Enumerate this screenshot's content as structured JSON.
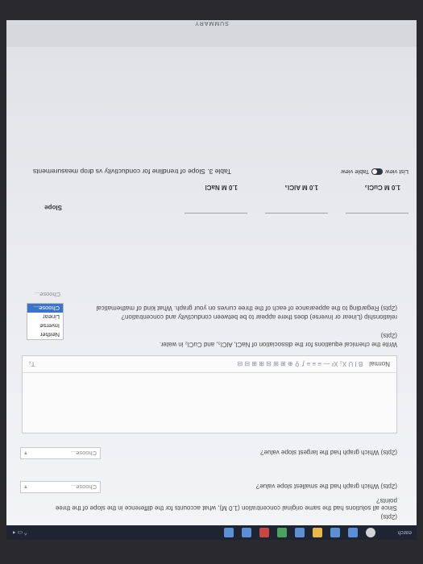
{
  "taskbar": {
    "search_label": "earch",
    "tray_text": "^ ▭ ◂"
  },
  "q_last": {
    "points": "(2pts)",
    "question": "Since all solutions had the same original concentration (1.0 M), what accounts for the difference in the slope of the three points?"
  },
  "q_smallest": {
    "question": "(2pts)  Which graph had the smallest slope value?",
    "select": "Choose..."
  },
  "q_largest": {
    "question": "(2pts)  Which graph had the largest slope value?",
    "select": "Choose..."
  },
  "editor": {
    "format": "Normal",
    "tools": "B  I  U     X₂  X²  —     ≡ ≡ ≡     ƒ   ⚲   ⊕   ⊞     ⊞ ⊟ ⊞  ⊞ ⊟ ⊟",
    "clear": "Tₓ"
  },
  "q_dissociation": {
    "points": "(2pts)",
    "question": "Write the chemical equations for the dissociation of NaCl, AlCl₃, and CuCl₂ in water."
  },
  "q_relationship": {
    "line1": "(2pts) Regarding to the appearance of each of the three curves on your graph. What kind of mathematical",
    "line2": "relationship (Linear or Inverse) does there appear to be between conductivity and concentration?",
    "select": "Choose...",
    "options": [
      "Choose...",
      "Linear",
      "Inverse",
      "Neither"
    ]
  },
  "table": {
    "title": "Table 3. Slope of trendline for conductivity vs drop measurements",
    "row_label": "Slope",
    "columns": [
      "1.0 M NaCl",
      "1.0 M AlCl₃",
      "1.0 M CuCl₂"
    ],
    "view_table": "Table view",
    "view_list": "List view"
  },
  "header": {
    "label": "SUMMARY"
  }
}
